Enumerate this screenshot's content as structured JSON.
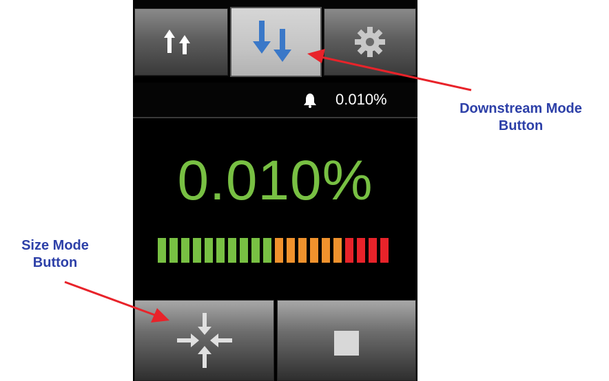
{
  "toolbar": {
    "buttons": [
      {
        "name": "upstream-mode",
        "icon": "up-up-arrows-icon",
        "selected": false
      },
      {
        "name": "downstream-mode",
        "icon": "down-down-arrows-icon",
        "selected": true
      },
      {
        "name": "settings",
        "icon": "gear-icon",
        "selected": false
      }
    ]
  },
  "status": {
    "alarm_icon": "bell-icon",
    "alarm_value": "0.010%"
  },
  "reading": {
    "value": "0.010%",
    "color": "#78c043",
    "level_bar": {
      "total_segments": 20,
      "green_segments": 10,
      "orange_segments": 6,
      "red_segments": 4,
      "colors": {
        "green": "#78c043",
        "orange": "#f0922d",
        "red": "#e8232a"
      }
    }
  },
  "bottom": {
    "buttons": [
      {
        "name": "size-mode",
        "icon": "converging-arrows-icon"
      },
      {
        "name": "stop",
        "icon": "stop-square-icon"
      }
    ]
  },
  "annotations": {
    "downstream_line1": "Downstream Mode",
    "downstream_line2": "Button",
    "size_line1": "Size Mode",
    "size_line2": "Button",
    "color": "#2d40a8",
    "arrow_color": "#e8232a"
  }
}
